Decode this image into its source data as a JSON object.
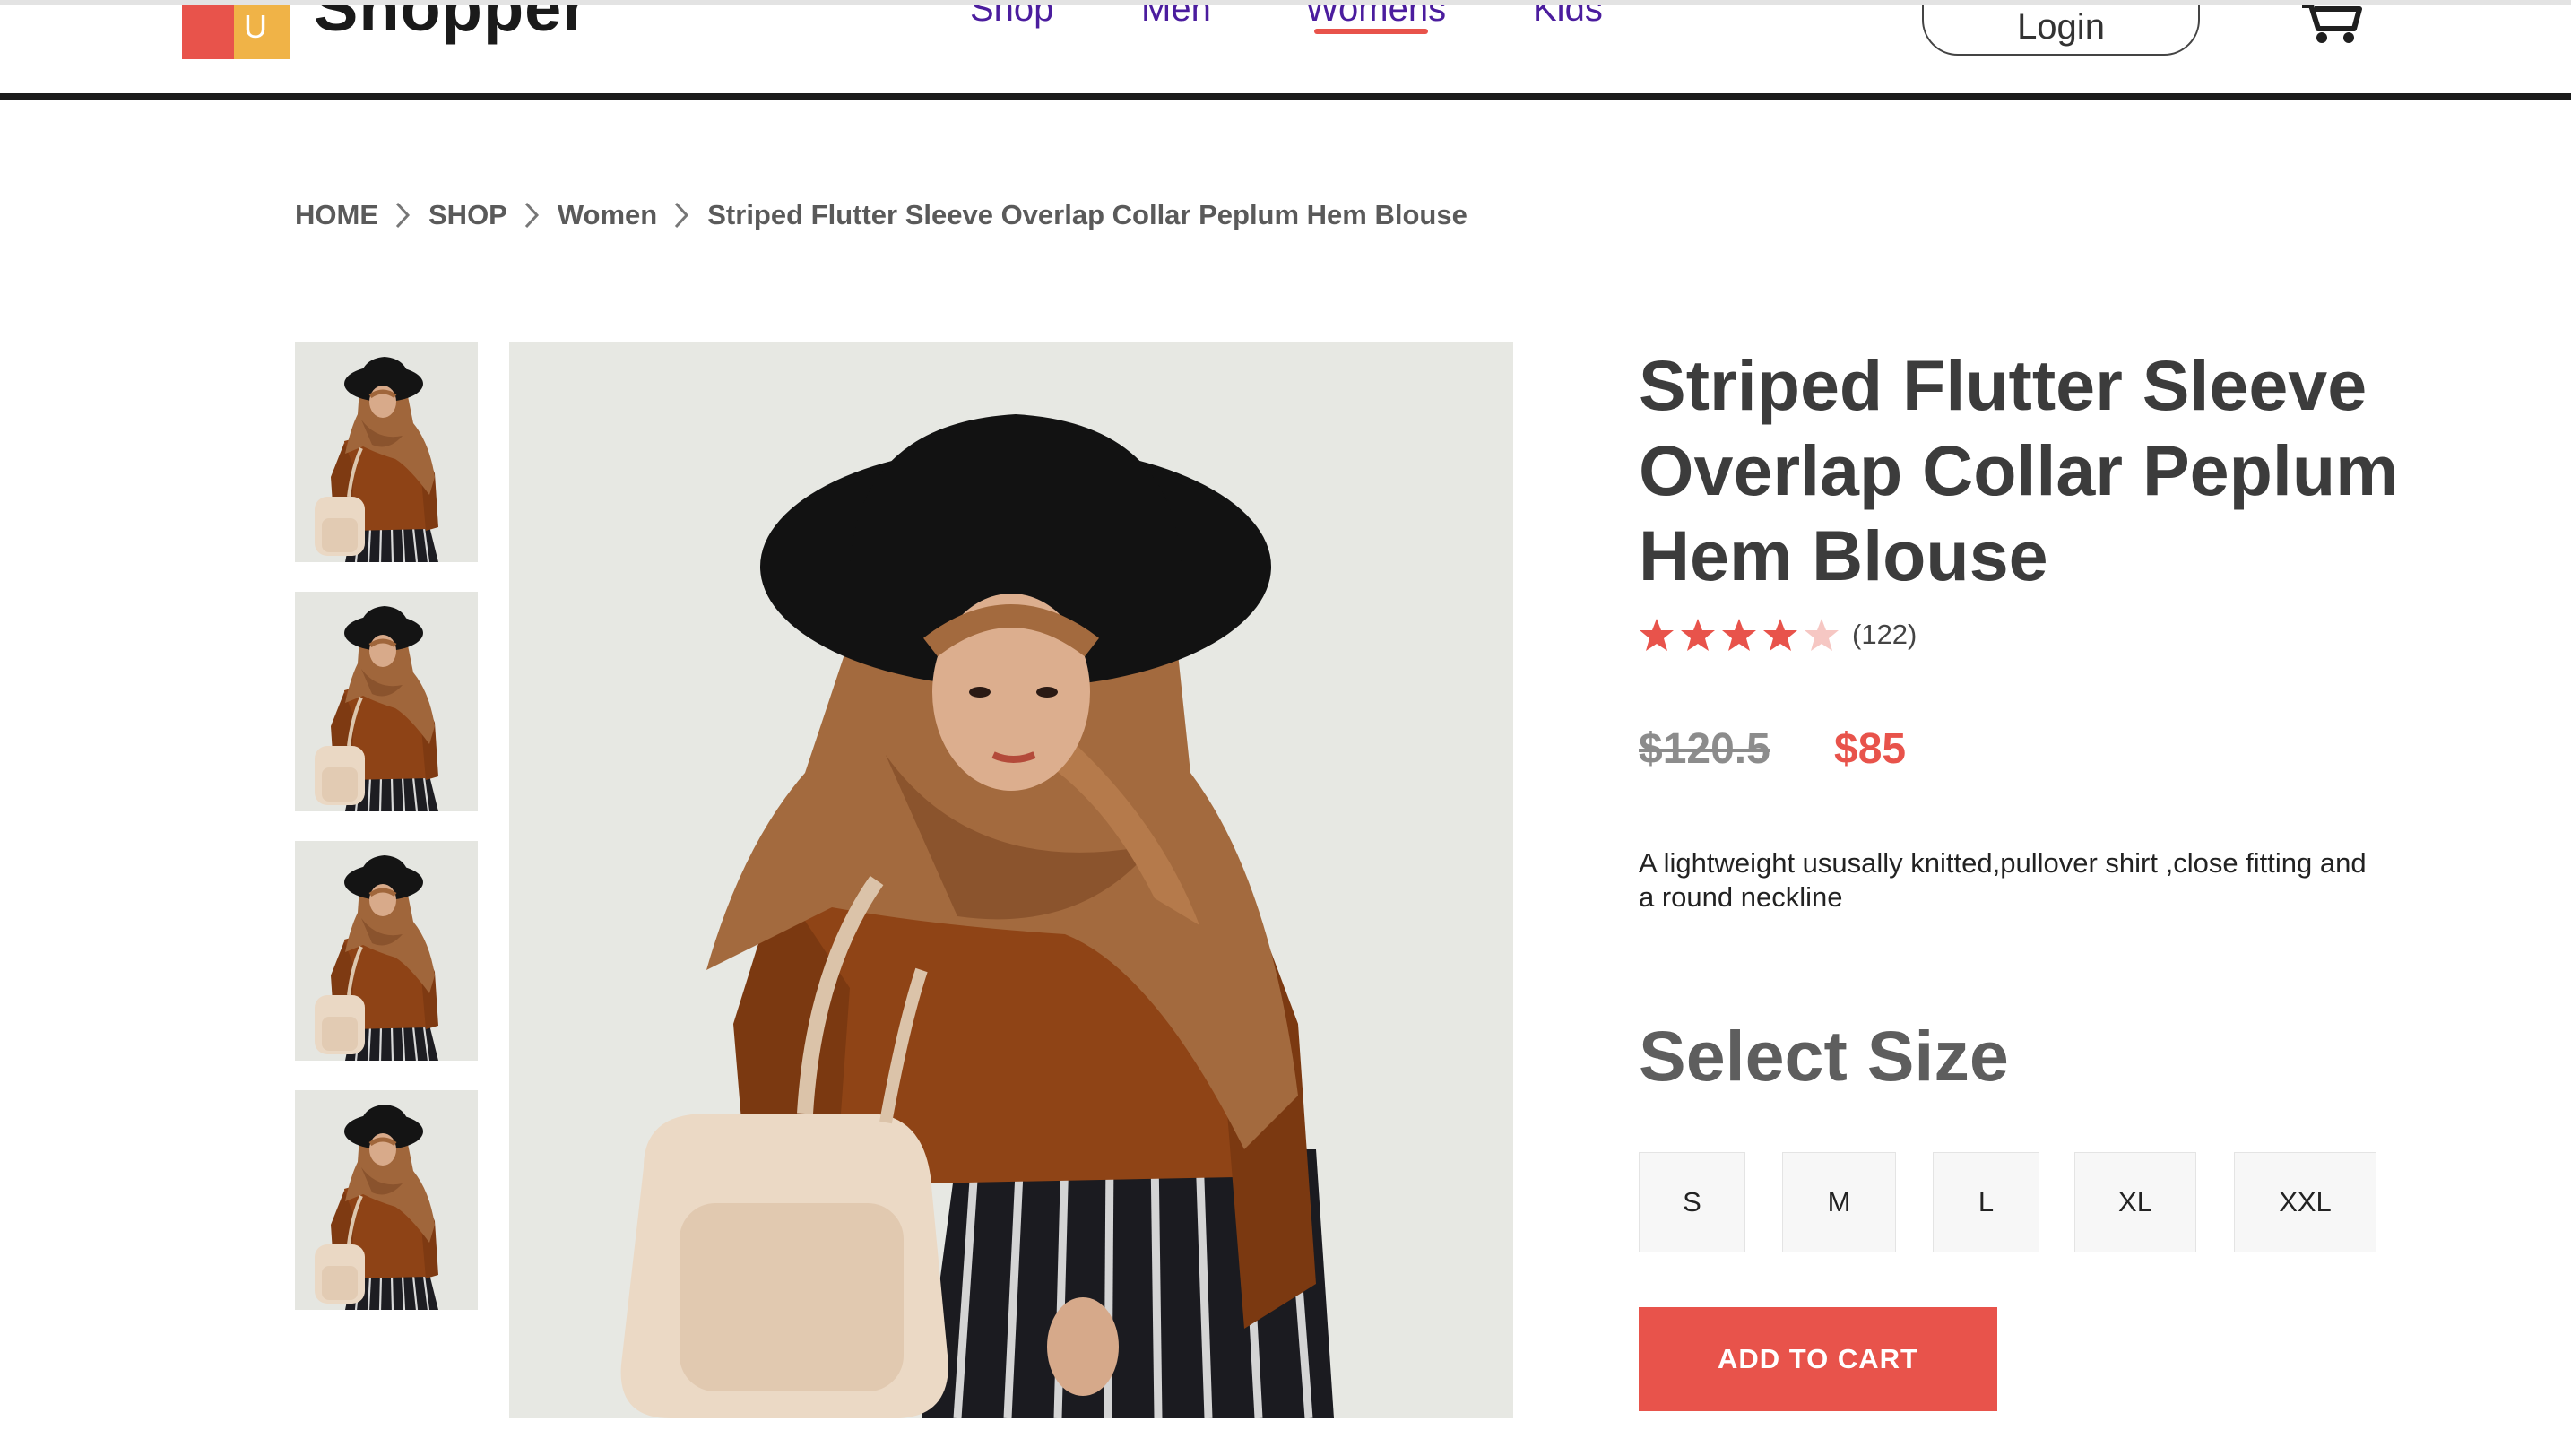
{
  "header": {
    "brand": "Shopper",
    "logo_letter": "U",
    "nav": [
      {
        "label": "Shop",
        "active": false
      },
      {
        "label": "Men",
        "active": false
      },
      {
        "label": "Womens",
        "active": true
      },
      {
        "label": "Kids",
        "active": false
      }
    ],
    "login_label": "Login",
    "cart_icon": "cart-icon"
  },
  "breadcrumb": {
    "items": [
      "HOME",
      "SHOP",
      "Women",
      "Striped Flutter Sleeve Overlap Collar Peplum Hem Blouse"
    ],
    "separator_icon": "chevron-right-icon"
  },
  "product": {
    "title": "Striped Flutter Sleeve Overlap Collar Peplum Hem Blouse",
    "rating": 4,
    "rating_max": 5,
    "review_count": "(122)",
    "old_price": "$120.5",
    "price": "$85",
    "description": "A lightweight ususally knitted,pullover shirt ,close fitting and a round neckline",
    "size_heading": "Select Size",
    "sizes": [
      "S",
      "M",
      "L",
      "XL",
      "XXL"
    ],
    "add_to_cart_label": "ADD TO CART"
  },
  "colors": {
    "accent": "#e8534b",
    "nav_text": "#4b1d9e",
    "title_text": "#3c3c3c",
    "star_filled": "#e8534b",
    "star_empty": "#f6c7c3"
  }
}
